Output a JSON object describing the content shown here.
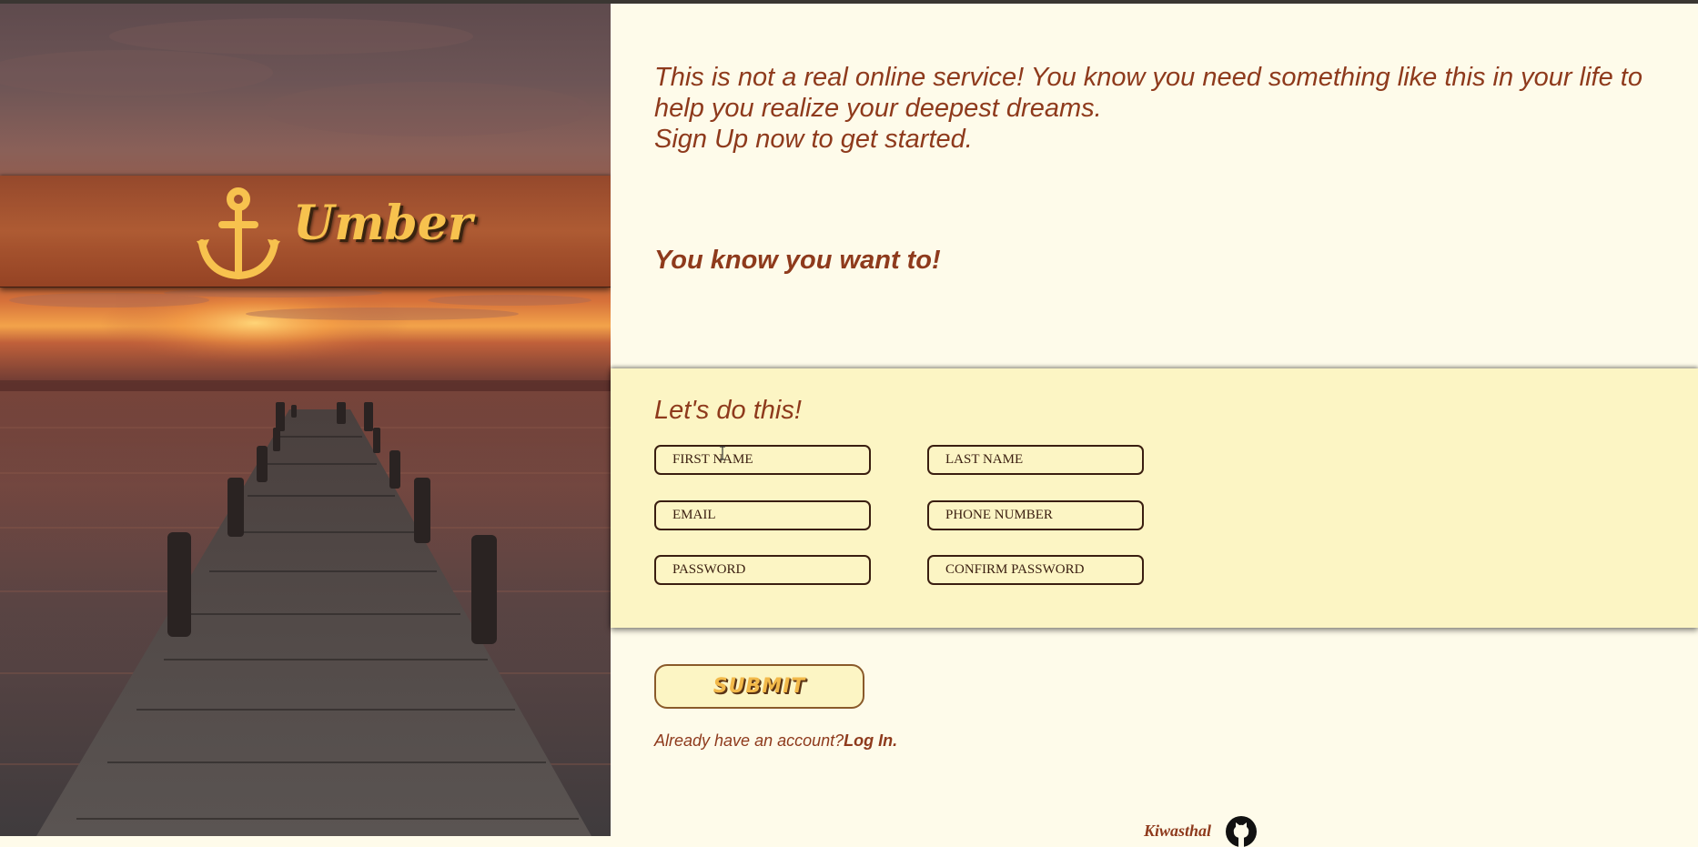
{
  "brand": {
    "name": "Umber",
    "logo_icon": "anchor-icon",
    "accent_color": "#f7c24e"
  },
  "intro": {
    "line1": "This is not a real online service! You know you need something like this in your life to help you realize your deepest dreams.",
    "line2": "Sign Up now to get started.",
    "tagline": "You know you want to!"
  },
  "form": {
    "title": "Let's do this!",
    "fields": {
      "first_name": "FIRST NAME",
      "last_name": "LAST NAME",
      "email": "EMAIL",
      "phone": "PHONE NUMBER",
      "password": "PASSWORD",
      "confirm_password": "CONFIRM PASSWORD"
    },
    "submit_label": "SUBMIT"
  },
  "login": {
    "prompt": "Already have an account?",
    "link_label": "Log In."
  },
  "footer": {
    "author": "Kiwasthal",
    "icon": "github-icon"
  },
  "colors": {
    "text": "#8e3a1c",
    "background": "#fefbea",
    "form_band": "#fcf5c4",
    "field_border": "#3a1e10"
  }
}
